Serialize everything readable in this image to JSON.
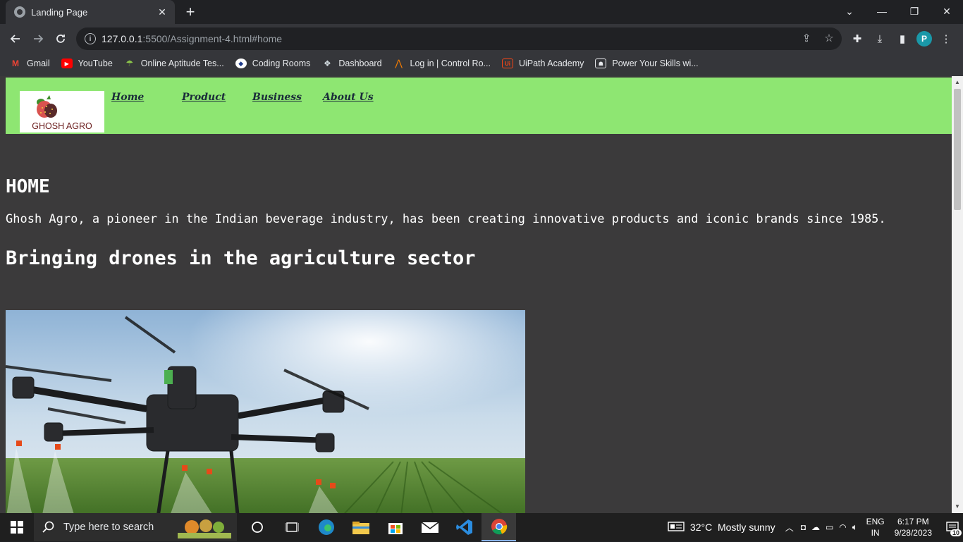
{
  "browser": {
    "tab_title": "Landing Page",
    "tab_close": "✕",
    "new_tab": "+",
    "window_controls": {
      "dropdown": "⌄",
      "minimize": "—",
      "restore": "❐",
      "close": "✕"
    },
    "url_host": "127.0.0.1",
    "url_rest": ":5500/Assignment-4.html#home",
    "profile_initial": "P"
  },
  "bookmarks": [
    {
      "label": "Gmail",
      "icon": "gmail-icon"
    },
    {
      "label": "YouTube",
      "icon": "youtube-icon"
    },
    {
      "label": "Online Aptitude Tes...",
      "icon": "aptitude-icon"
    },
    {
      "label": "Coding Rooms",
      "icon": "coding-rooms-icon"
    },
    {
      "label": "Dashboard",
      "icon": "dashboard-icon"
    },
    {
      "label": "Log in | Control Ro...",
      "icon": "control-room-icon"
    },
    {
      "label": "UiPath Academy",
      "icon": "uipath-icon"
    },
    {
      "label": "Power Your Skills wi...",
      "icon": "power-skills-icon"
    }
  ],
  "site": {
    "logo_text": "GHOSH AGRO",
    "nav": [
      "Home",
      "Product",
      "Business",
      "About Us"
    ],
    "heading": "HOME",
    "intro": "Ghosh Agro, a pioneer in the Indian beverage industry, has been creating innovative products and iconic brands since 1985.",
    "subheading": "Bringing drones in the agriculture sector"
  },
  "taskbar": {
    "search_placeholder": "Type here to search",
    "weather": "32°C  Mostly sunny",
    "lang_top": "ENG",
    "lang_bottom": "IN",
    "time": "6:17 PM",
    "date": "9/28/2023",
    "notifications": "10"
  },
  "colors": {
    "navbar": "#8ee672",
    "page_bg": "#3b3a3b",
    "accent": "#1a98a8"
  }
}
